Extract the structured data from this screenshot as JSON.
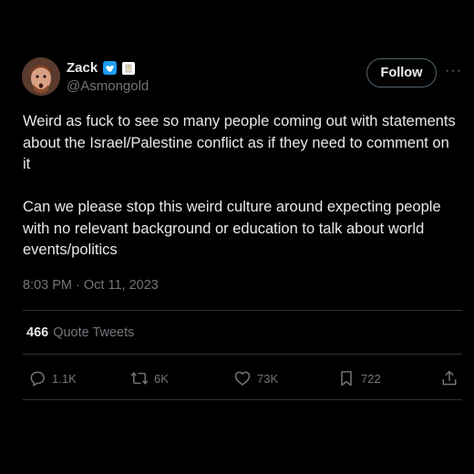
{
  "author": {
    "display_name": "Zack",
    "handle": "@Asmongold",
    "verified": true
  },
  "follow_button_label": "Follow",
  "tweet": {
    "paragraph1": "Weird as fuck to see so many people coming out with statements about the Israel/Palestine conflict as if they need to comment on it",
    "paragraph2": "Can we please stop this weird culture around expecting people with no relevant background or education to talk about world events/politics",
    "timestamp": "8:03 PM · Oct 11, 2023"
  },
  "stats": {
    "quote_count": "466",
    "quote_label": "Quote Tweets"
  },
  "actions": {
    "replies": "1.1K",
    "retweets": "6K",
    "likes": "73K",
    "bookmarks": "722"
  },
  "colors": {
    "background": "#000000",
    "text": "#e7e9ea",
    "secondary": "#71767b",
    "verified": "#1d9bf0",
    "divider": "#2f3336"
  }
}
